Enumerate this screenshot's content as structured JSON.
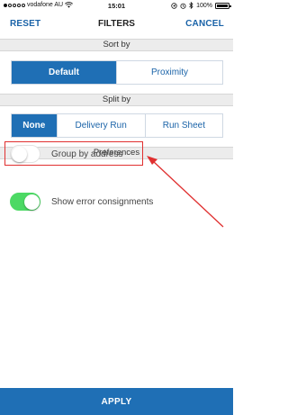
{
  "status_bar": {
    "carrier": "vodafone AU",
    "time": "15:01",
    "battery": "100%"
  },
  "nav": {
    "reset": "RESET",
    "title": "FILTERS",
    "cancel": "CANCEL"
  },
  "sort_by": {
    "header": "Sort by",
    "options": [
      "Default",
      "Proximity"
    ],
    "selected": "Default"
  },
  "split_by": {
    "header": "Split by",
    "options": [
      "None",
      "Delivery Run",
      "Run Sheet"
    ],
    "selected": "None"
  },
  "preferences": {
    "header": "Preferences",
    "items": [
      {
        "label": "Group by address",
        "enabled": false
      },
      {
        "label": "Show error consignments",
        "enabled": true
      }
    ]
  },
  "apply": "APPLY",
  "colors": {
    "accent": "#1f6fb5",
    "toggle_on": "#4cd964",
    "highlight": "#e03030"
  }
}
